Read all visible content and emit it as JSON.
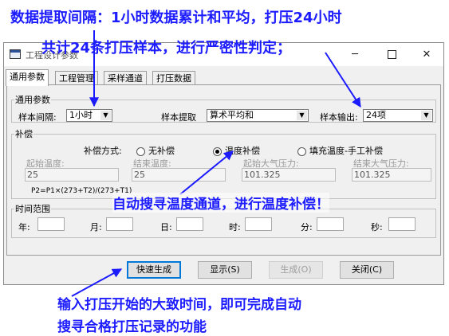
{
  "window": {
    "title": "工程设计参数",
    "controls": {
      "minimize": "─",
      "maximize": "□",
      "close": "✕"
    }
  },
  "tabs": [
    {
      "label": "通用参数",
      "active": true
    },
    {
      "label": "工程管理",
      "active": false
    },
    {
      "label": "采样通道",
      "active": false
    },
    {
      "label": "打压数据",
      "active": false
    }
  ],
  "general": {
    "legend": "通用参数",
    "interval_label": "样本间隔:",
    "interval_value": "1小时",
    "extract_label": "样本提取",
    "extract_value": "算术平均和",
    "output_label": "样本输出:",
    "output_value": "24项"
  },
  "compensation": {
    "legend": "补偿",
    "mode_label": "补偿方式:",
    "options": [
      "无补偿",
      "温度补偿",
      "填充温度-手工补偿"
    ],
    "selected": 1,
    "start_temp_label": "起始温度:",
    "start_temp_value": "25",
    "end_temp_label": "结束温度:",
    "end_temp_value": "25",
    "start_pressure_label": "起始大气压力:",
    "start_pressure_value": "101.325",
    "end_pressure_label": "结束大气压力:",
    "end_pressure_value": "101.325",
    "formula": "P2=P1×(273+T2)/(273+T1)"
  },
  "time_range": {
    "legend": "时间范围",
    "year": "年:",
    "month": "月:",
    "day": "日:",
    "hour": "时:",
    "minute": "分:",
    "second": "秒:"
  },
  "buttons": {
    "quick": "快速生成",
    "show": "显示(S)",
    "generate": "生成(O)",
    "close": "关闭(C)"
  },
  "annotations": {
    "line1": "数据提取间隔：1小时数据累计和平均，打压24小时",
    "line2": "共计24条打压样本，进行严密性判定；",
    "line3": "自动搜寻温度通道，进行温度补偿！",
    "line4": "输入打压开始的大致时间，即可完成自动",
    "line5": "搜寻合格打压记录的功能",
    "color": "#1c1cff"
  }
}
